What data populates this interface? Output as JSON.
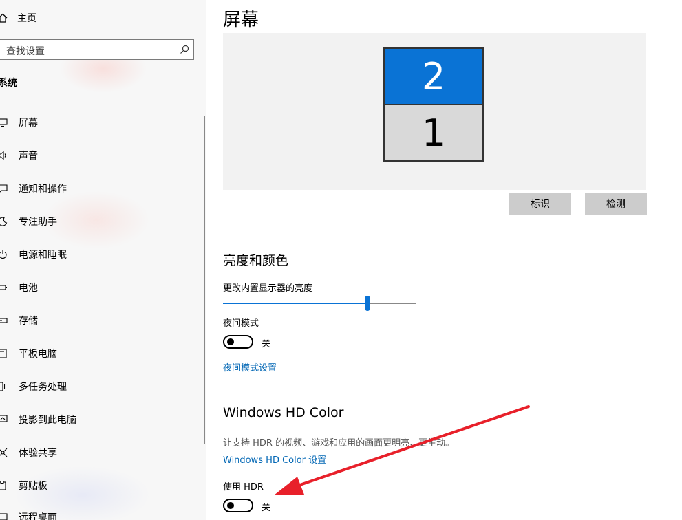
{
  "sidebar": {
    "home_label": "主页",
    "search_placeholder": "查找设置",
    "section_label": "系统",
    "items": [
      {
        "label": "屏幕",
        "icon": "monitor-icon"
      },
      {
        "label": "声音",
        "icon": "speaker-icon"
      },
      {
        "label": "通知和操作",
        "icon": "message-icon"
      },
      {
        "label": "专注助手",
        "icon": "moon-icon"
      },
      {
        "label": "电源和睡眠",
        "icon": "power-icon"
      },
      {
        "label": "电池",
        "icon": "battery-icon"
      },
      {
        "label": "存储",
        "icon": "storage-icon"
      },
      {
        "label": "平板电脑",
        "icon": "tablet-icon"
      },
      {
        "label": "多任务处理",
        "icon": "multitask-icon"
      },
      {
        "label": "投影到此电脑",
        "icon": "project-icon"
      },
      {
        "label": "体验共享",
        "icon": "share-icon"
      },
      {
        "label": "剪贴板",
        "icon": "clipboard-icon"
      },
      {
        "label": "远程桌面",
        "icon": "remote-desktop-icon"
      }
    ]
  },
  "main": {
    "title": "屏幕",
    "displays": {
      "top": "2",
      "bottom": "1"
    },
    "identify_label": "标识",
    "detect_label": "检测",
    "brightness_heading": "亮度和颜色",
    "brightness_label": "更改内置显示器的亮度",
    "brightness_value": 0.75,
    "night_mode_label": "夜间模式",
    "night_mode_state": "关",
    "night_mode_settings_link": "夜间模式设置",
    "hd_heading": "Windows HD Color",
    "hd_description": "让支持 HDR 的视频、游戏和应用的画面更明亮、更生动。",
    "hd_settings_link": "Windows HD Color 设置",
    "hdr_label": "使用 HDR",
    "hdr_state": "关"
  },
  "colors": {
    "accent": "#0a73d5",
    "annotation_arrow": "#e8202a",
    "link": "#0066b4"
  }
}
